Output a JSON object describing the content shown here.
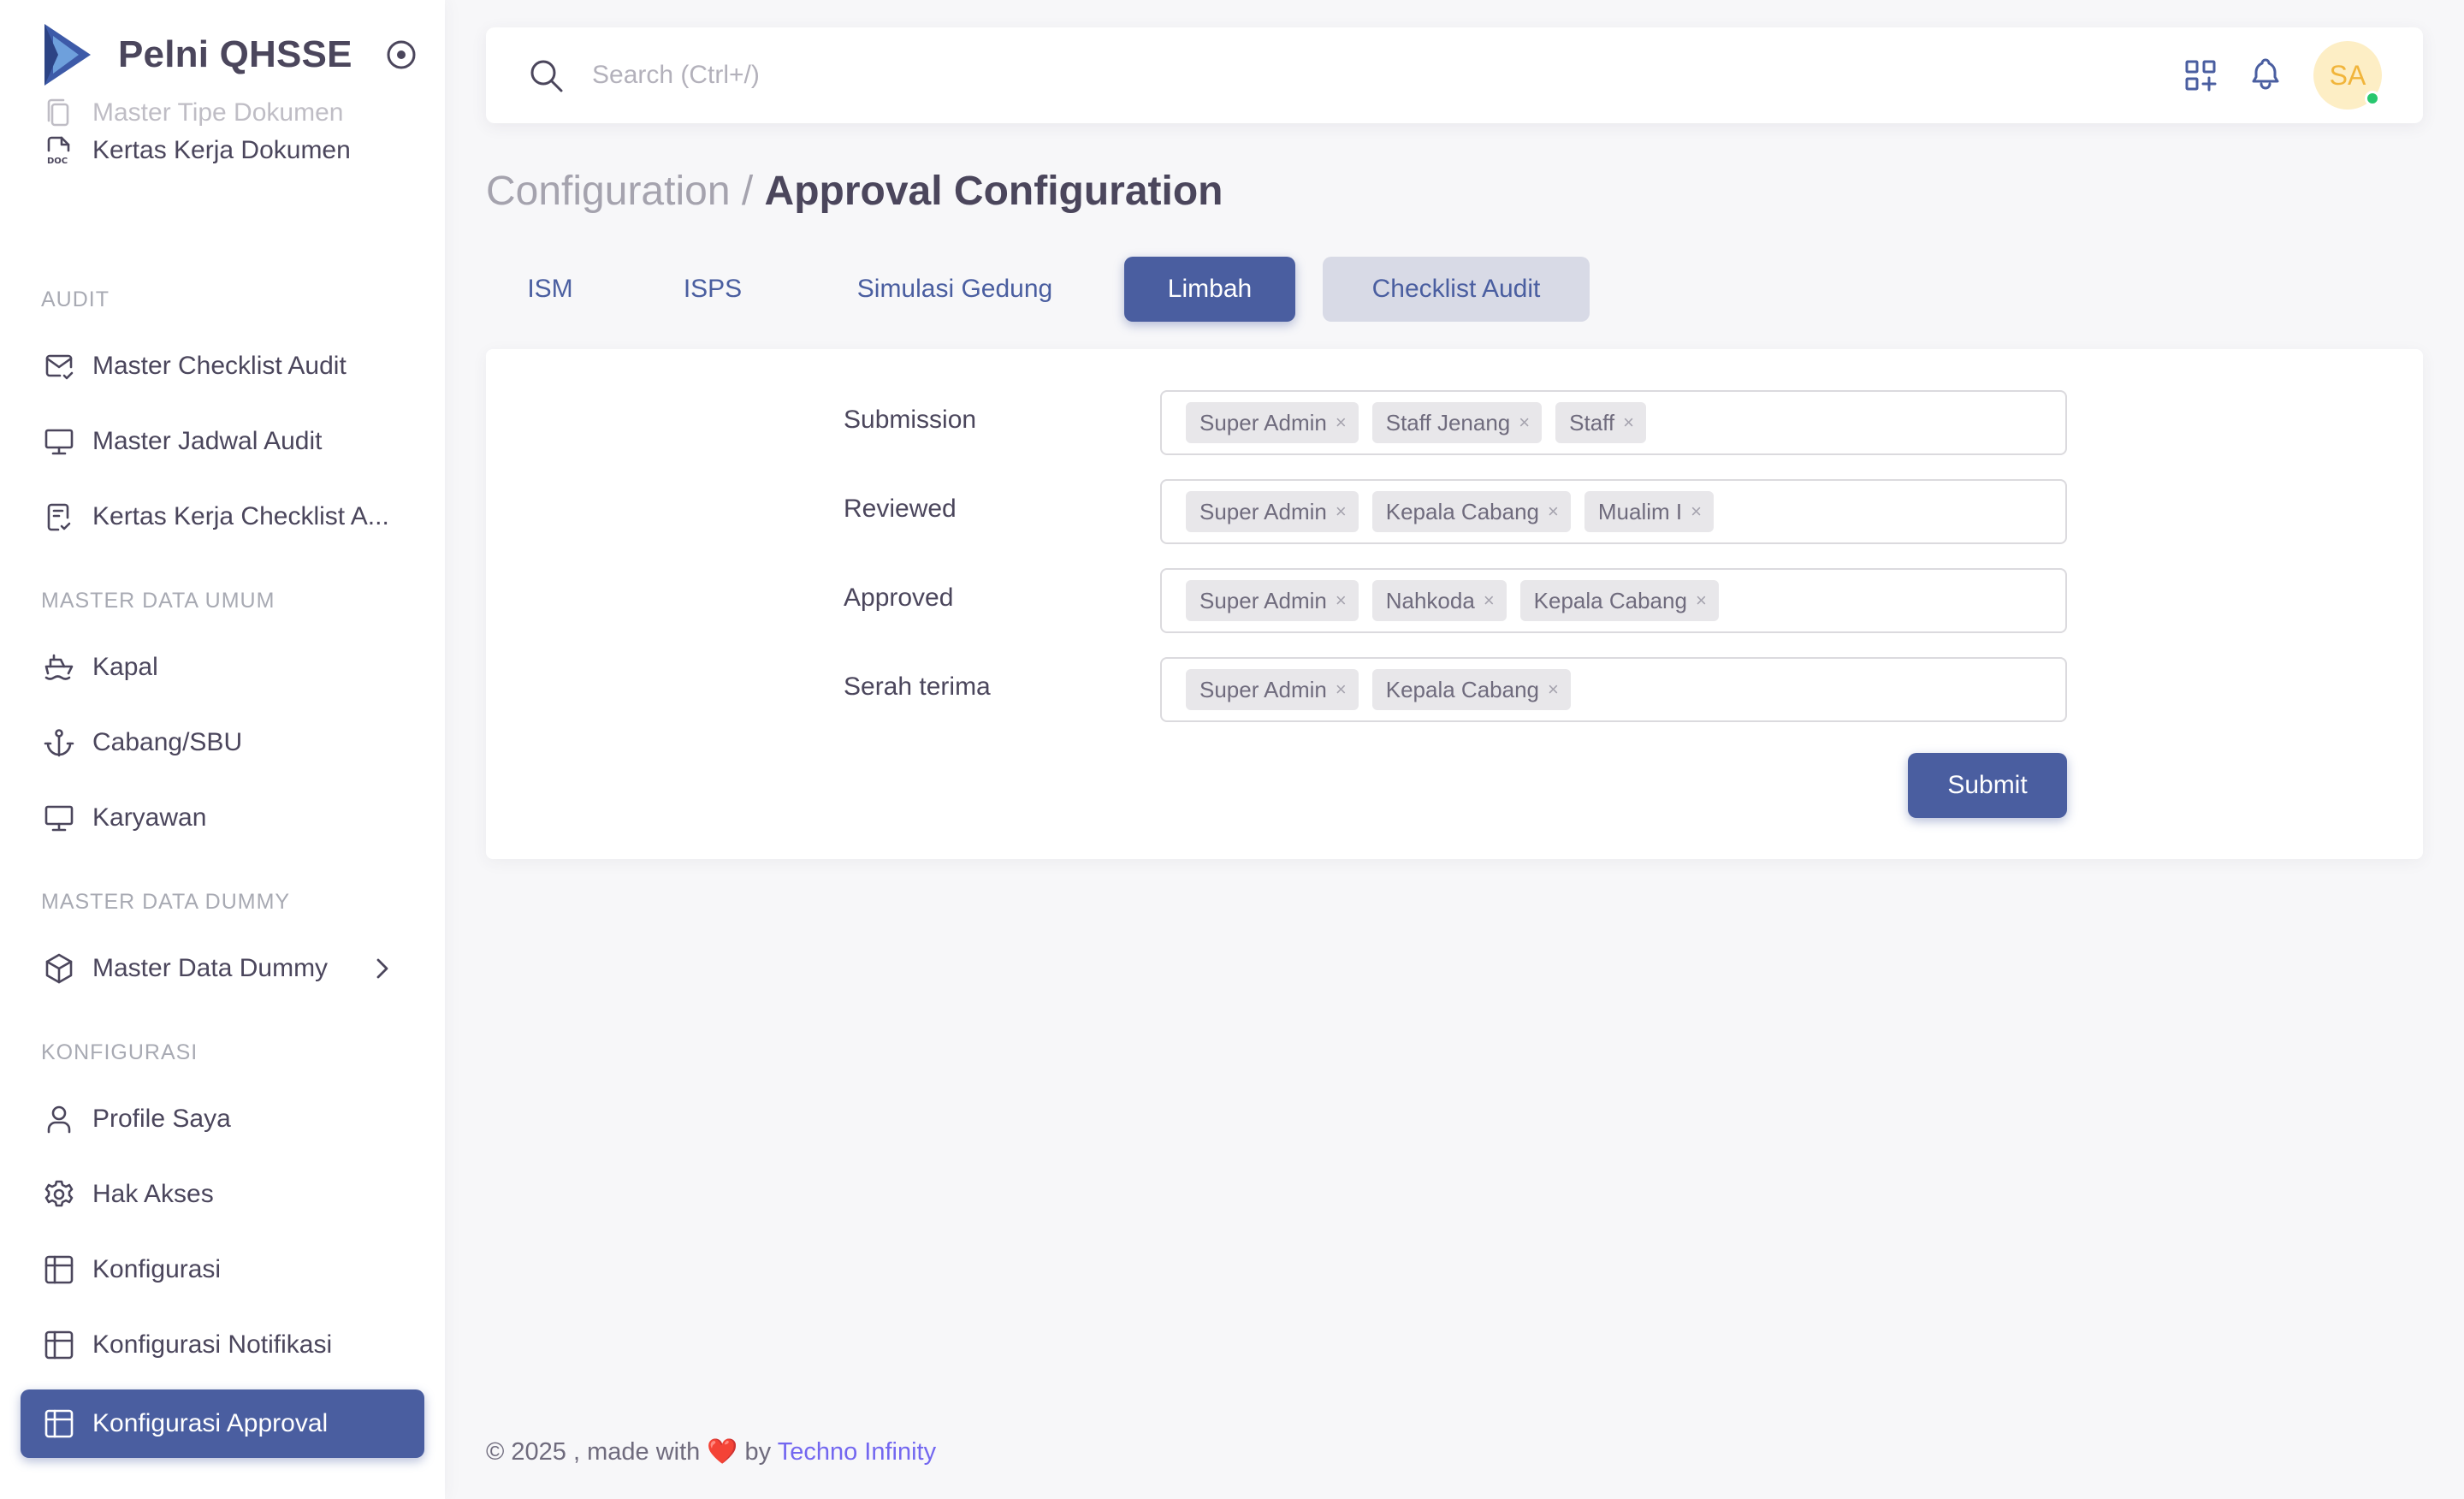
{
  "app": {
    "name": "Pelni QHSSE"
  },
  "sidebar": {
    "items": [
      {
        "label": "Master Tipe Dokumen",
        "icon": "document-copy-icon"
      },
      {
        "label": "Kertas Kerja Dokumen",
        "icon": "doc-file-icon"
      },
      {
        "label": "Master Checklist Audit",
        "icon": "mail-check-icon"
      },
      {
        "label": "Master Jadwal Audit",
        "icon": "monitor-icon"
      },
      {
        "label": "Kertas Kerja Checklist A...",
        "icon": "clipboard-check-icon"
      },
      {
        "label": "Kapal",
        "icon": "ship-icon"
      },
      {
        "label": "Cabang/SBU",
        "icon": "anchor-icon"
      },
      {
        "label": "Karyawan",
        "icon": "monitor-icon"
      },
      {
        "label": "Master Data Dummy",
        "icon": "box-icon"
      },
      {
        "label": "Profile Saya",
        "icon": "user-icon"
      },
      {
        "label": "Hak Akses",
        "icon": "gear-icon"
      },
      {
        "label": "Konfigurasi",
        "icon": "table-icon"
      },
      {
        "label": "Konfigurasi Notifikasi",
        "icon": "table-icon"
      },
      {
        "label": "Konfigurasi Approval",
        "icon": "table-icon"
      }
    ],
    "sections": {
      "audit": "AUDIT",
      "master_data_umum": "MASTER DATA UMUM",
      "master_data_dummy": "MASTER DATA DUMMY",
      "konfigurasi": "KONFIGURASI"
    },
    "active_color": "#4a5ea0"
  },
  "topbar": {
    "search_placeholder": "Search (Ctrl+/)",
    "avatar_initials": "SA",
    "avatar_status_color": "#28c76f"
  },
  "breadcrumb": {
    "parent": "Configuration",
    "separator": " / ",
    "current": "Approval Configuration"
  },
  "tabs": [
    {
      "label": "ISM",
      "state": "default"
    },
    {
      "label": "ISPS",
      "state": "default"
    },
    {
      "label": "Simulasi Gedung",
      "state": "default"
    },
    {
      "label": "Limbah",
      "state": "active"
    },
    {
      "label": "Checklist Audit",
      "state": "hover"
    }
  ],
  "form": {
    "rows": [
      {
        "label": "Submission",
        "values": [
          "Super Admin",
          "Staff Jenang",
          "Staff"
        ]
      },
      {
        "label": "Reviewed",
        "values": [
          "Super Admin",
          "Kepala Cabang",
          "Mualim I"
        ]
      },
      {
        "label": "Approved",
        "values": [
          "Super Admin",
          "Nahkoda",
          "Kepala Cabang"
        ]
      },
      {
        "label": "Serah terima",
        "values": [
          "Super Admin",
          "Kepala Cabang"
        ]
      }
    ],
    "chip_remove": "×",
    "submit_label": "Submit"
  },
  "footer": {
    "prefix": "© 2025 , made with",
    "heart": "❤️",
    "by": "by",
    "company": "Techno Infinity"
  }
}
